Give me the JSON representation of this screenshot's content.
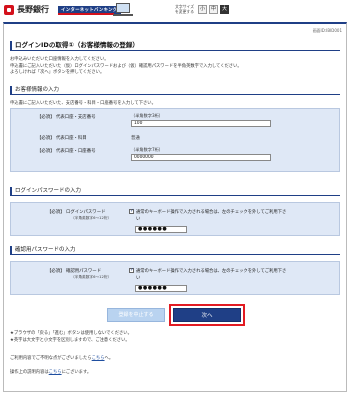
{
  "header": {
    "bank_name": "長野銀行",
    "service_label": "インターネットバンキング",
    "font_size_label": "文字サイズを変更する",
    "font_sizes": [
      "小",
      "中",
      "大"
    ]
  },
  "screen_id": "画面ID:IBID001",
  "page_title": "ログインIDの取得①（お客様情報の登録）",
  "intro_lines": [
    "お申込みいただいた口座情報を入力してください。",
    "申込書にご記入いただいた（仮）ログインパスワードおよび（仮）確認用パスワードを半角英数字で入力してください。",
    "よろしければ「次へ」ボタンを押してください。"
  ],
  "customer_section": {
    "title": "お客様情報の入力",
    "desc": "申込書にご記入いただいた、支店番号・科目・口座番号を入力して下さい。",
    "rows": [
      {
        "label": "【必須】 代表口座・支店番号",
        "hint": "（半角数字3桁）",
        "value": "100"
      },
      {
        "label": "【必須】 代表口座・科目",
        "value": "普通"
      },
      {
        "label": "【必須】 代表口座・口座番号",
        "hint": "（半角数字7桁）",
        "value": "0000000"
      }
    ]
  },
  "login_pw_section": {
    "title": "ログインパスワードの入力",
    "label": "【必須】 ログインパスワード",
    "sub": "（半角英数字6～12桁）",
    "kb_line1": "通常のキーボード操作で入力される場合は、左のチェックを外してご利用下さ",
    "kb_line2": "い",
    "masked_value": "●●●●●●"
  },
  "confirm_pw_section": {
    "title": "確認用パスワードの入力",
    "label": "【必須】 確認用パスワード",
    "sub": "（半角英数字6～12桁）",
    "kb_line1": "通常のキーボード操作で入力される場合は、左のチェックを外してご利用下さ",
    "kb_line2": "い",
    "masked_value": "●●●●●●"
  },
  "buttons": {
    "cancel_label": "登録を中止する",
    "next_label": "次へ"
  },
  "notes": {
    "browser_note": "★ブラウザの「戻る」「進む」ボタンは使用しないでください。",
    "case_note": "★英字は大文字と小文字を区別しますので、ご注意ください。",
    "inquiry_prefix": "ご利用内容でご不明な点がございましたら",
    "inquiry_link": "こちら",
    "inquiry_suffix": "へ。",
    "manual_prefix": "操作上の説明内容は",
    "manual_link": "こちら",
    "manual_suffix": "にございます。"
  }
}
